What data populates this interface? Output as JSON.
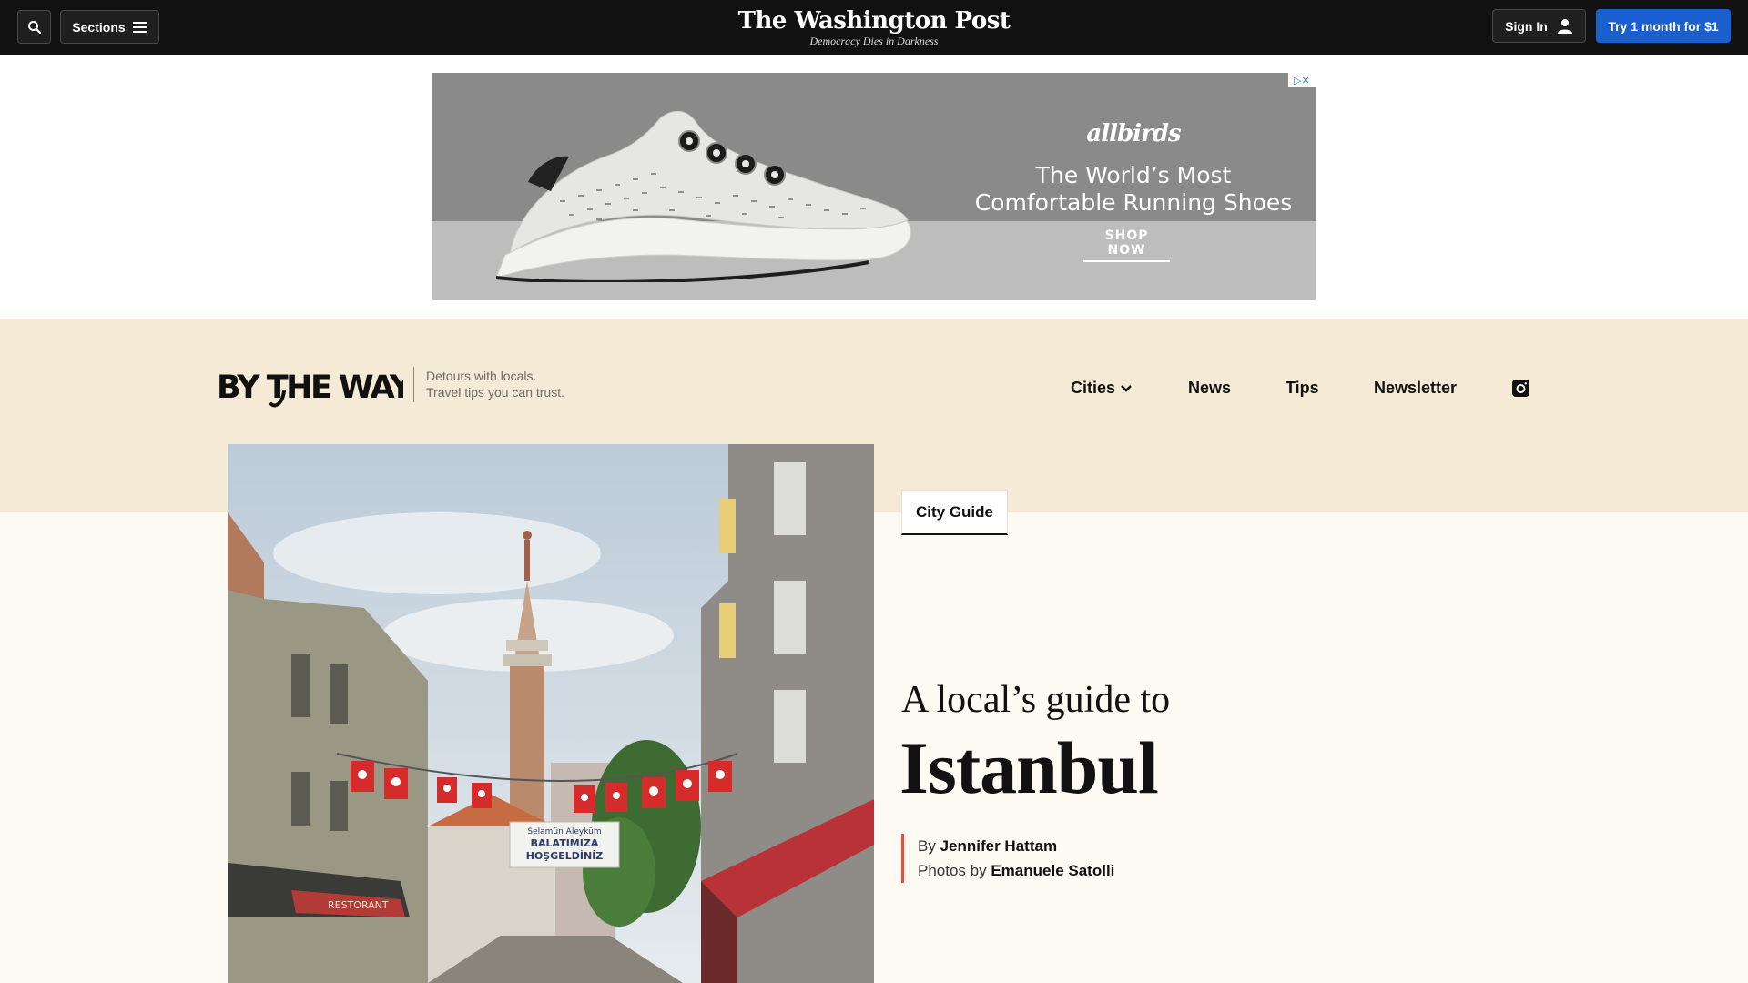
{
  "topbar": {
    "search_icon": "search-icon",
    "sections_label": "Sections",
    "masthead_title": "The Washington Post",
    "masthead_tagline": "Democracy Dies in Darkness",
    "signin_label": "Sign In",
    "try_label": "Try 1 month for $1"
  },
  "ad": {
    "brand": "allbirds",
    "headline_line1": "The World’s Most",
    "headline_line2": "Comfortable Running Shoes",
    "cta": "SHOP NOW",
    "choices_label": "▷✕"
  },
  "section": {
    "logo_text": "BY THE WAY",
    "tagline_line1": "Detours with locals.",
    "tagline_line2": "Travel tips you can trust.",
    "nav": [
      {
        "label": "Cities"
      },
      {
        "label": "News"
      },
      {
        "label": "Tips"
      },
      {
        "label": "Newsletter"
      }
    ]
  },
  "article": {
    "category": "City Guide",
    "kicker": "A local’s guide to",
    "title": "Istanbul",
    "by_prefix": "By",
    "author": "Jennifer Hattam",
    "photos_prefix": "Photos by",
    "photographer": "Emanuele Satolli"
  },
  "hero_image": {
    "banner_line1": "Selamün Aleyküm",
    "banner_line2": "BALATIMIZA",
    "banner_line3": "HOŞGELDİNİZ",
    "shop_sign": "RESTORANT"
  },
  "colors": {
    "topbar_bg": "#111111",
    "accent_blue": "#1a5fd0",
    "band_bg": "#f5ead6",
    "byline_rule": "#e0523a"
  }
}
